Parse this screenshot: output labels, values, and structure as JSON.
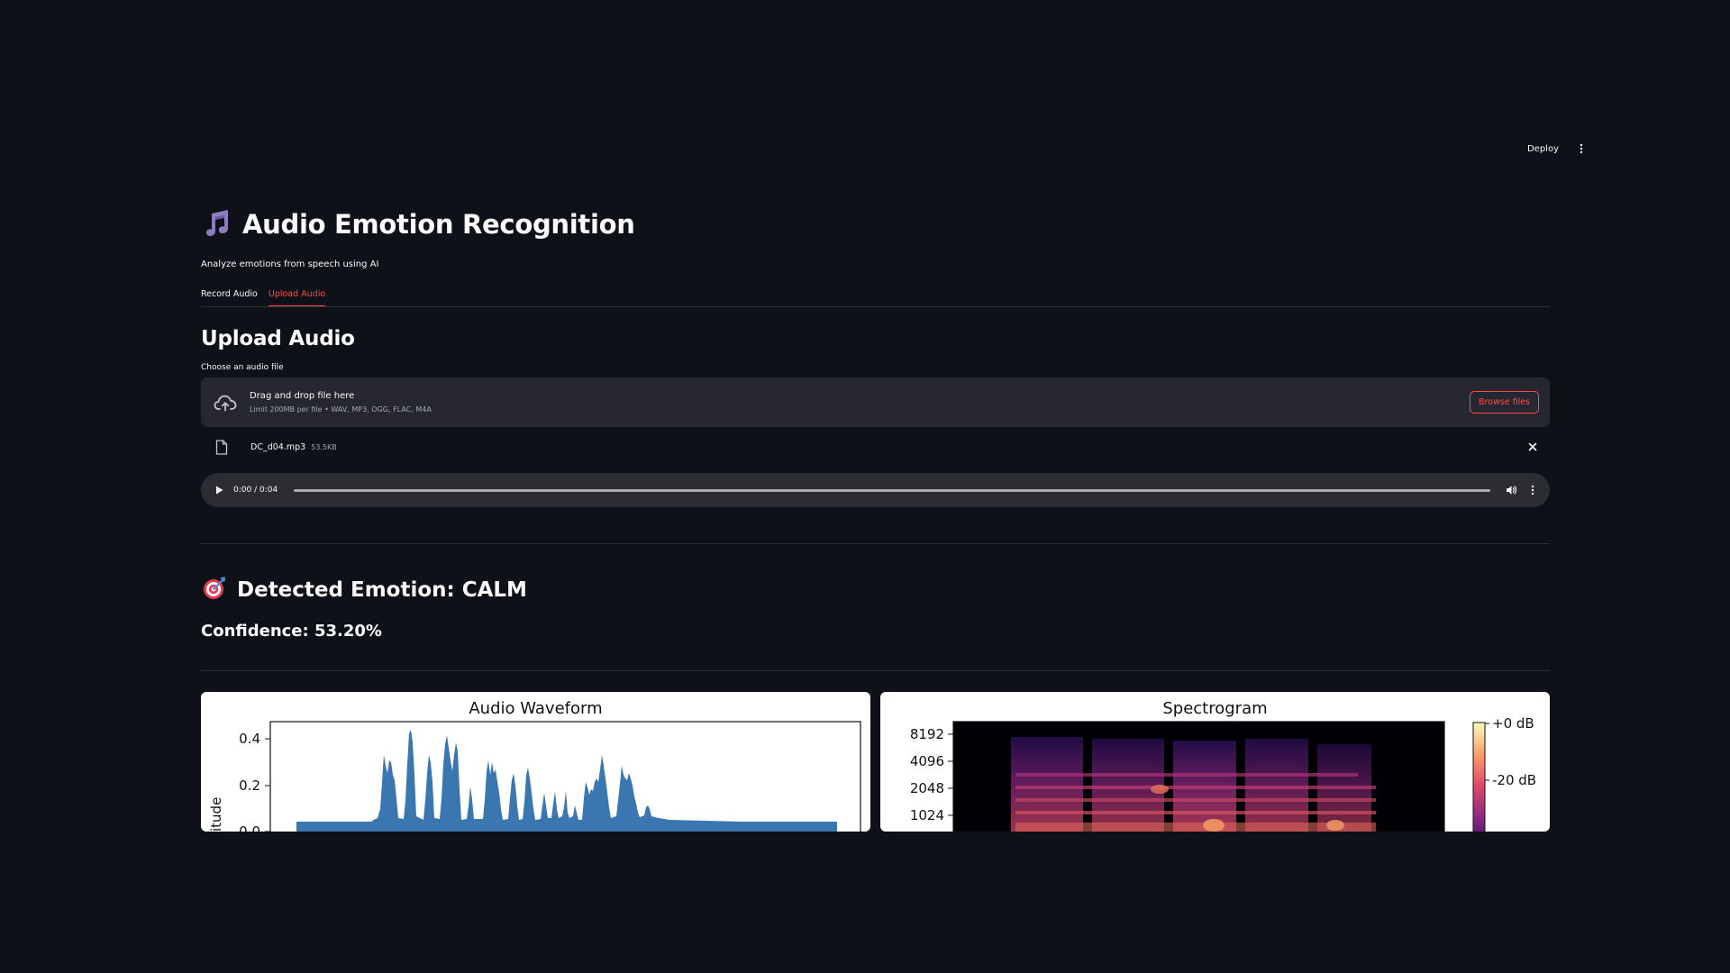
{
  "header": {
    "deploy_label": "Deploy",
    "menu_icon": "kebab-vertical-icon"
  },
  "app": {
    "title_icon": "musical-notes-icon",
    "title": "Audio Emotion Recognition",
    "subtitle": "Analyze emotions from speech using AI"
  },
  "tabs": [
    {
      "label": "Record Audio",
      "active": false
    },
    {
      "label": "Upload Audio",
      "active": true
    }
  ],
  "upload": {
    "section_title": "Upload Audio",
    "field_label": "Choose an audio file",
    "dropzone_main": "Drag and drop file here",
    "dropzone_sub": "Limit 200MB per file • WAV, MP3, OGG, FLAC, M4A",
    "browse_label": "Browse files",
    "file": {
      "name": "DC_d04.mp3",
      "size": "53.5KB"
    }
  },
  "player": {
    "time": "0:00 / 0:04",
    "progress": 0
  },
  "result": {
    "icon": "target-icon",
    "emotion_title": "Detected Emotion: CALM",
    "confidence": "Confidence: 53.20%"
  },
  "charts": {
    "waveform": {
      "title": "Audio Waveform",
      "ylabel_visible": "itude",
      "yticks": [
        "0.4",
        "0.2",
        "0.0"
      ],
      "color": "#3a76af"
    },
    "spectrogram": {
      "title": "Spectrogram",
      "yticks": [
        "8192",
        "4096",
        "2048",
        "1024"
      ],
      "colorbar_ticks": [
        "+0 dB",
        "-20 dB"
      ],
      "colormap": "magma"
    }
  },
  "colors": {
    "background": "#0e1117",
    "accent": "#ff4b4b",
    "surface": "#262730"
  }
}
